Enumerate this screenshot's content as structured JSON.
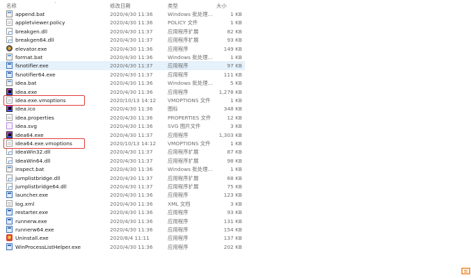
{
  "columns": {
    "name": "名称",
    "date": "修改日期",
    "type": "类型",
    "size": "大小"
  },
  "selected_row": 7,
  "highlighted_rows": [
    11,
    16
  ],
  "files": [
    {
      "name": "append.bat",
      "date": "2020/4/30 11:36",
      "type": "Windows 批处理...",
      "size": "1 KB",
      "icon": "bat"
    },
    {
      "name": "appletviewer.policy",
      "date": "2020/4/30 11:36",
      "type": "POLICY 文件",
      "size": "1 KB",
      "icon": "doc"
    },
    {
      "name": "breakgen.dll",
      "date": "2020/4/30 11:37",
      "type": "应用程序扩展",
      "size": "82 KB",
      "icon": "dll"
    },
    {
      "name": "breakgen64.dll",
      "date": "2020/4/30 11:37",
      "type": "应用程序扩展",
      "size": "93 KB",
      "icon": "dll"
    },
    {
      "name": "elevator.exe",
      "date": "2020/4/30 11:36",
      "type": "应用程序",
      "size": "149 KB",
      "icon": "elev"
    },
    {
      "name": "format.bat",
      "date": "2020/4/30 11:36",
      "type": "Windows 批处理...",
      "size": "1 KB",
      "icon": "bat"
    },
    {
      "name": "fsnotifier.exe",
      "date": "2020/4/30 11:37",
      "type": "应用程序",
      "size": "97 KB",
      "icon": "exe"
    },
    {
      "name": "fsnotifier64.exe",
      "date": "2020/4/30 11:37",
      "type": "应用程序",
      "size": "111 KB",
      "icon": "exe"
    },
    {
      "name": "idea.bat",
      "date": "2020/4/30 11:36",
      "type": "Windows 批处理...",
      "size": "5 KB",
      "icon": "bat"
    },
    {
      "name": "idea.exe",
      "date": "2020/4/30 11:36",
      "type": "应用程序",
      "size": "1,278 KB",
      "icon": "idea"
    },
    {
      "name": "idea.exe.vmoptions",
      "date": "2020/10/13 14:12",
      "type": "VMOPTIONS 文件",
      "size": "1 KB",
      "icon": "doc"
    },
    {
      "name": "idea.ico",
      "date": "2020/4/30 11:36",
      "type": "图标",
      "size": "348 KB",
      "icon": "idea"
    },
    {
      "name": "idea.properties",
      "date": "2020/4/30 11:36",
      "type": "PROPERTIES 文件",
      "size": "12 KB",
      "icon": "doc"
    },
    {
      "name": "idea.svg",
      "date": "2020/4/30 11:36",
      "type": "SVG 图片文件",
      "size": "3 KB",
      "icon": "svg"
    },
    {
      "name": "idea64.exe",
      "date": "2020/4/30 11:37",
      "type": "应用程序",
      "size": "1,303 KB",
      "icon": "idea"
    },
    {
      "name": "idea64.exe.vmoptions",
      "date": "2020/10/13 14:12",
      "type": "VMOPTIONS 文件",
      "size": "1 KB",
      "icon": "doc"
    },
    {
      "name": "IdeaWin32.dll",
      "date": "2020/4/30 11:37",
      "type": "应用程序扩展",
      "size": "87 KB",
      "icon": "dll"
    },
    {
      "name": "IdeaWin64.dll",
      "date": "2020/4/30 11:37",
      "type": "应用程序扩展",
      "size": "98 KB",
      "icon": "dll"
    },
    {
      "name": "inspect.bat",
      "date": "2020/4/30 11:36",
      "type": "Windows 批处理...",
      "size": "1 KB",
      "icon": "bat"
    },
    {
      "name": "jumplistbridge.dll",
      "date": "2020/4/30 11:37",
      "type": "应用程序扩展",
      "size": "68 KB",
      "icon": "dll"
    },
    {
      "name": "jumplistbridge64.dll",
      "date": "2020/4/30 11:37",
      "type": "应用程序扩展",
      "size": "75 KB",
      "icon": "dll"
    },
    {
      "name": "launcher.exe",
      "date": "2020/4/30 11:36",
      "type": "应用程序",
      "size": "123 KB",
      "icon": "exe"
    },
    {
      "name": "log.xml",
      "date": "2020/4/30 11:36",
      "type": "XML 文档",
      "size": "3 KB",
      "icon": "xml"
    },
    {
      "name": "restarter.exe",
      "date": "2020/4/30 11:36",
      "type": "应用程序",
      "size": "93 KB",
      "icon": "exe"
    },
    {
      "name": "runnerw.exe",
      "date": "2020/4/30 11:36",
      "type": "应用程序",
      "size": "131 KB",
      "icon": "exe"
    },
    {
      "name": "runnerw64.exe",
      "date": "2020/4/30 11:36",
      "type": "应用程序",
      "size": "154 KB",
      "icon": "exe"
    },
    {
      "name": "Uninstall.exe",
      "date": "2020/8/4 11:11",
      "type": "应用程序",
      "size": "137 KB",
      "icon": "uninst"
    },
    {
      "name": "WinProcessListHelper.exe",
      "date": "2020/4/30 11:36",
      "type": "应用程序",
      "size": "202 KB",
      "icon": "exe"
    }
  ],
  "colors": {
    "selection": "#e5f1fb",
    "highlight_border": "#e23636"
  }
}
